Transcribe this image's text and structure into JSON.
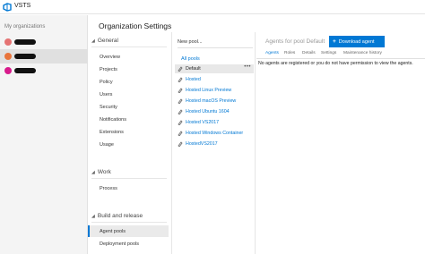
{
  "app": {
    "name": "VSTS",
    "brand_color": "#0078d4"
  },
  "org_pane": {
    "heading": "My organizations",
    "orgs": [
      {
        "initial": "G",
        "color": "#e57373"
      },
      {
        "initial": "G",
        "color": "#e8743b"
      },
      {
        "initial": "M",
        "color": "#d81b8c"
      }
    ]
  },
  "settings": {
    "title": "Organization Settings"
  },
  "nav": {
    "sections": [
      {
        "label": "General",
        "items": [
          "Overview",
          "Projects",
          "Policy",
          "Users",
          "Security",
          "Notifications",
          "Extensions",
          "Usage"
        ]
      },
      {
        "label": "Work",
        "items": [
          "Process"
        ]
      },
      {
        "label": "Build and release",
        "items": [
          "Agent pools",
          "Deployment pools"
        ]
      }
    ],
    "active_item": "Agent pools"
  },
  "pools": {
    "new_pool_label": "New pool...",
    "all_pools_label": "All pools",
    "more_label": "•••",
    "items": [
      "Default",
      "Hosted",
      "Hosted Linux Preview",
      "Hosted macOS Preview",
      "Hosted Ubuntu 1604",
      "Hosted VS2017",
      "Hosted Windows Container",
      "HostedVS2017"
    ],
    "selected": "Default"
  },
  "detail": {
    "title": "Agents for pool Default",
    "download_button": "Download agent",
    "tabs": [
      "Agents",
      "Roles",
      "Details",
      "Settings",
      "Maintenance history"
    ],
    "active_tab": "Agents",
    "empty_message": "No agents are registered or you do not have permission to view the agents."
  }
}
